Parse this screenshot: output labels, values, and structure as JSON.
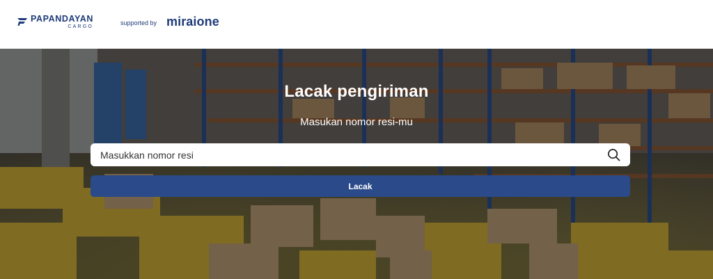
{
  "header": {
    "brand_name": "PAPANDAYAN",
    "brand_sub": "CARGO",
    "supported_text": "supported by",
    "partner_name": "miraione"
  },
  "hero": {
    "title": "Lacak pengiriman",
    "subtitle": "Masukan nomor resi-mu",
    "search": {
      "value": "",
      "placeholder": "Masukkan nomor resi",
      "icon": "search-icon"
    },
    "button_label": "Lacak"
  },
  "colors": {
    "brand": "#1f3b79",
    "button": "#2a4a8a",
    "hero_text": "#ffffff"
  }
}
